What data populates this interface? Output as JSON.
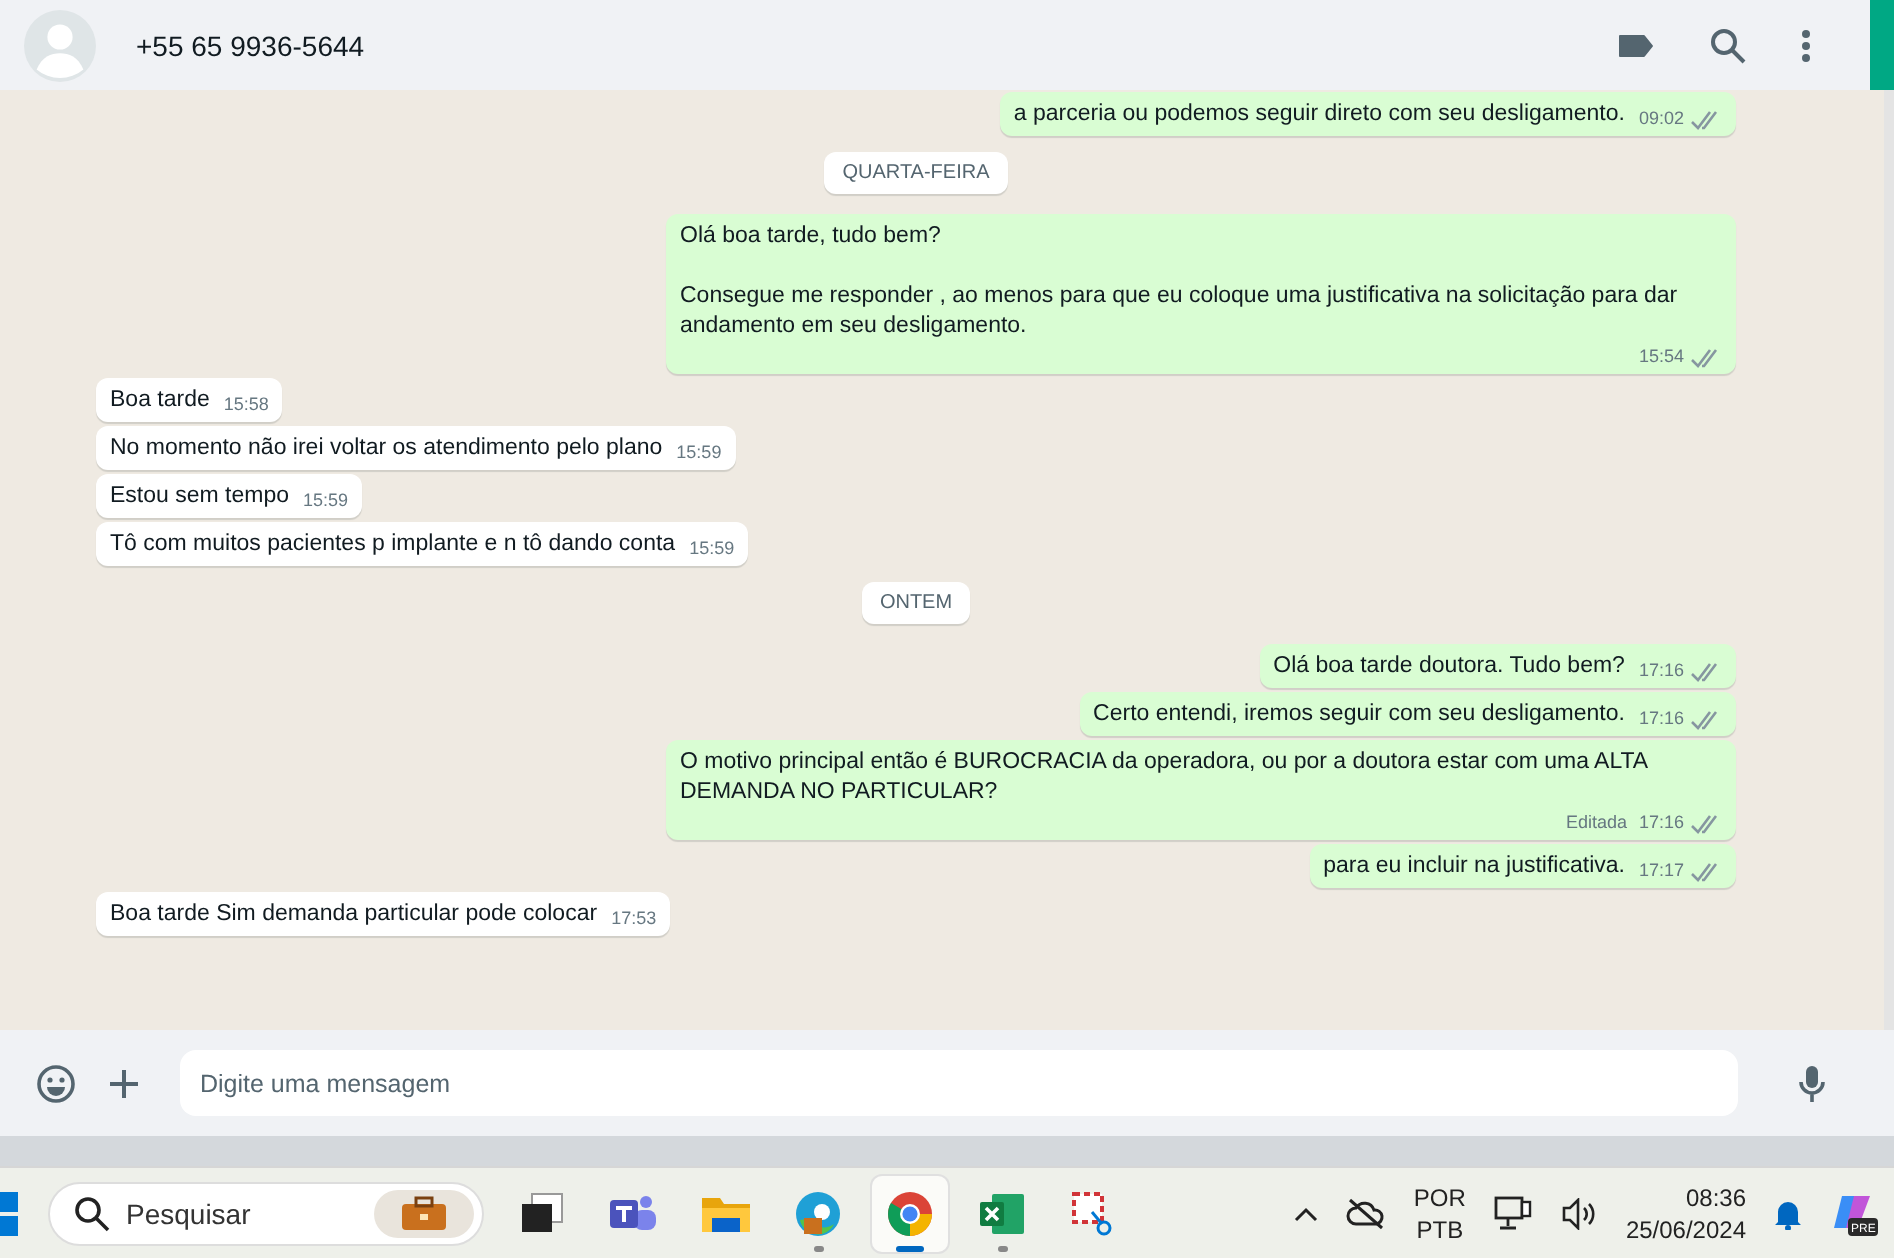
{
  "header": {
    "contact": "+55 65 9936-5644"
  },
  "messages": [
    {
      "kind": "out",
      "lines": [
        "a parceria ou podemos seguir direto com seu desligamento."
      ],
      "time": "09:02",
      "read": false
    },
    {
      "kind": "date",
      "text": "QUARTA-FEIRA"
    },
    {
      "kind": "out",
      "lines": [
        "Olá boa tarde, tudo bem?",
        "Consegue me responder , ao menos para que eu coloque uma justificativa na solicitação para dar andamento em seu desligamento."
      ],
      "time": "15:54",
      "read": false
    },
    {
      "kind": "in",
      "lines": [
        "Boa tarde"
      ],
      "time": "15:58"
    },
    {
      "kind": "in",
      "lines": [
        "No momento não irei voltar os atendimento pelo plano"
      ],
      "time": "15:59"
    },
    {
      "kind": "in",
      "lines": [
        "Estou sem tempo"
      ],
      "time": "15:59"
    },
    {
      "kind": "in",
      "lines": [
        "Tô com muitos pacientes p implante e n tô dando conta"
      ],
      "time": "15:59"
    },
    {
      "kind": "date",
      "text": "ONTEM"
    },
    {
      "kind": "out",
      "lines": [
        "Olá boa tarde doutora. Tudo bem?"
      ],
      "time": "17:16",
      "read": false
    },
    {
      "kind": "out",
      "lines": [
        "Certo entendi, iremos seguir com seu desligamento."
      ],
      "time": "17:16",
      "read": false
    },
    {
      "kind": "out",
      "lines": [
        "O motivo principal então é BUROCRACIA da operadora, ou por a doutora estar com uma ALTA DEMANDA NO PARTICULAR?"
      ],
      "time": "17:16",
      "read": false,
      "edited_label": "Editada"
    },
    {
      "kind": "out",
      "lines": [
        "para eu incluir na justificativa."
      ],
      "time": "17:17",
      "read": false
    },
    {
      "kind": "in",
      "lines": [
        "Boa tarde Sim demanda particular pode colocar"
      ],
      "time": "17:53"
    }
  ],
  "composer": {
    "placeholder": "Digite uma mensagem"
  },
  "taskbar": {
    "search_placeholder": "Pesquisar",
    "apps": [
      {
        "kind": "taskview",
        "selected": false,
        "running": false
      },
      {
        "kind": "teams",
        "selected": false,
        "running": false
      },
      {
        "kind": "folder",
        "selected": false,
        "running": false
      },
      {
        "kind": "edge",
        "selected": false,
        "running": true
      },
      {
        "kind": "chrome",
        "selected": true,
        "running": true
      },
      {
        "kind": "excel",
        "selected": false,
        "running": true
      },
      {
        "kind": "snip",
        "selected": false,
        "running": false
      }
    ],
    "copilot_badge": "PRE",
    "lang": [
      "POR",
      "PTB"
    ],
    "time": "08:36",
    "date": "25/06/2024"
  }
}
